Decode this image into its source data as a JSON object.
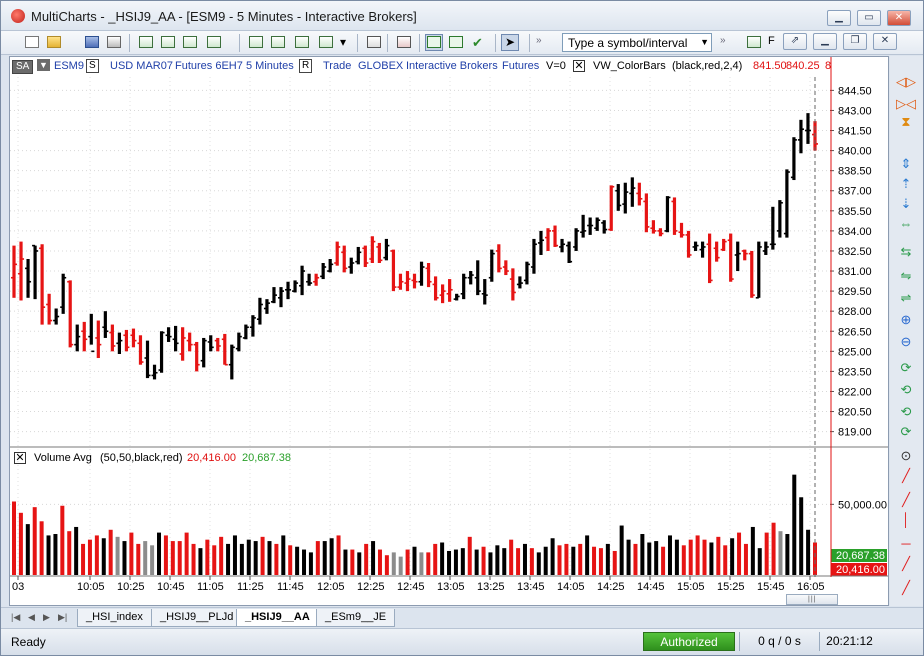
{
  "window": {
    "title": "MultiCharts - _HSIJ9_AA - [ESM9 - 5 Minutes - Interactive Brokers]",
    "buttons": [
      "_",
      "▭",
      "✕"
    ]
  },
  "toolbar": {
    "symbol_placeholder": "Type a symbol/interval",
    "overflow_label": "F"
  },
  "status_line": {
    "sa_label": "SA",
    "symbol": "ESM9",
    "s_box": "S",
    "currency": "USD MAR07",
    "futures": "Futures 6EH7",
    "interval": "5 Minutes",
    "r_box": "R",
    "trade": "Trade",
    "exchange": "GLOBEX",
    "broker": "Interactive Brokers",
    "category": "Futures",
    "v_zero": "V=0",
    "indicator": "VW_ColorBars",
    "indicator_params": "(black,red,2,4)",
    "val1": "841.50",
    "val2": "840.25",
    "val3": "8"
  },
  "volume_status": {
    "name": "Volume Avg",
    "params": "(50,50,black,red)",
    "val_red": "20,416.00",
    "val_green": "20,687.38"
  },
  "colors": {
    "up": "#000000",
    "down": "#e61414",
    "neutral": "#8c8c8c",
    "avg_red": "#e61414",
    "avg_green": "#2aa02a"
  },
  "chart_data": {
    "type": "bar",
    "title": "",
    "price_axis": {
      "min": 818.0,
      "max": 845.5,
      "ticks": [
        "844.50",
        "843.00",
        "841.50",
        "840.00",
        "838.50",
        "837.00",
        "835.50",
        "834.00",
        "832.50",
        "831.00",
        "829.50",
        "828.00",
        "826.50",
        "825.00",
        "823.50",
        "822.00",
        "820.50",
        "819.00"
      ]
    },
    "time_axis": {
      "ticks": [
        "03",
        "10:05",
        "10:25",
        "10:45",
        "11:05",
        "11:25",
        "11:45",
        "12:05",
        "12:25",
        "12:45",
        "13:05",
        "13:25",
        "13:45",
        "14:05",
        "14:25",
        "14:45",
        "15:05",
        "15:25",
        "15:45",
        "16:05"
      ]
    },
    "ohlc": [
      [
        830.5,
        832.9,
        829.0,
        831.5,
        "down"
      ],
      [
        830.8,
        833.2,
        828.8,
        831.9,
        "down"
      ],
      [
        831.2,
        831.9,
        829.0,
        830.2,
        "up"
      ],
      [
        832.9,
        832.9,
        828.9,
        832.5,
        "up"
      ],
      [
        832.7,
        833.0,
        827.0,
        828.3,
        "down"
      ],
      [
        828.5,
        829.3,
        827.0,
        827.3,
        "down"
      ],
      [
        827.3,
        828.2,
        827.0,
        827.6,
        "up"
      ],
      [
        828.3,
        830.8,
        827.8,
        830.5,
        "up"
      ],
      [
        830.2,
        830.3,
        825.3,
        825.5,
        "down"
      ],
      [
        825.5,
        827.0,
        825.0,
        826.1,
        "up"
      ],
      [
        826.5,
        827.2,
        825.0,
        825.9,
        "down"
      ],
      [
        826.1,
        827.8,
        825.5,
        825.0,
        "up"
      ],
      [
        826.0,
        827.3,
        824.5,
        825.5,
        "down"
      ],
      [
        826.8,
        828.0,
        826.0,
        826.5,
        "up"
      ],
      [
        826.4,
        827.0,
        825.0,
        825.4,
        "down"
      ],
      [
        825.6,
        826.4,
        824.8,
        825.8,
        "up"
      ],
      [
        826.2,
        826.6,
        825.0,
        825.3,
        "down"
      ],
      [
        826.2,
        826.7,
        825.3,
        825.8,
        "down"
      ],
      [
        825.6,
        826.2,
        824.0,
        824.2,
        "down"
      ],
      [
        824.5,
        825.8,
        823.0,
        823.2,
        "up"
      ],
      [
        823.2,
        824.0,
        822.9,
        823.4,
        "up"
      ],
      [
        823.6,
        826.5,
        823.4,
        826.4,
        "up"
      ],
      [
        826.2,
        826.8,
        825.7,
        826.1,
        "up"
      ],
      [
        825.9,
        826.9,
        825.0,
        825.6,
        "up"
      ],
      [
        824.8,
        826.8,
        824.3,
        826.0,
        "down"
      ],
      [
        825.8,
        826.4,
        825.0,
        825.5,
        "down"
      ],
      [
        825.5,
        825.7,
        823.5,
        824.0,
        "down"
      ],
      [
        824.3,
        826.0,
        823.8,
        825.8,
        "up"
      ],
      [
        825.7,
        826.2,
        825.0,
        825.3,
        "up"
      ],
      [
        825.8,
        826.0,
        825.0,
        825.4,
        "down"
      ],
      [
        825.9,
        826.3,
        824.0,
        824.0,
        "down"
      ],
      [
        824.0,
        825.5,
        822.9,
        825.3,
        "up"
      ],
      [
        825.2,
        826.4,
        825.0,
        826.1,
        "up"
      ],
      [
        826.0,
        827.0,
        825.9,
        826.8,
        "up"
      ],
      [
        826.8,
        827.7,
        826.1,
        827.5,
        "up"
      ],
      [
        827.4,
        829.0,
        827.0,
        828.5,
        "up"
      ],
      [
        828.2,
        828.9,
        827.8,
        828.6,
        "up"
      ],
      [
        828.7,
        829.8,
        828.6,
        829.2,
        "up"
      ],
      [
        829.0,
        829.8,
        828.3,
        829.5,
        "up"
      ],
      [
        829.6,
        830.2,
        828.9,
        829.6,
        "up"
      ],
      [
        829.5,
        830.3,
        829.4,
        830.1,
        "up"
      ],
      [
        829.9,
        831.4,
        829.2,
        831.0,
        "up"
      ],
      [
        830.2,
        830.8,
        829.9,
        830.1,
        "up"
      ],
      [
        830.2,
        830.8,
        829.9,
        830.5,
        "down"
      ],
      [
        830.6,
        831.6,
        830.4,
        831.3,
        "up"
      ],
      [
        831.0,
        831.9,
        830.9,
        831.5,
        "up"
      ],
      [
        831.6,
        833.2,
        831.4,
        832.8,
        "down"
      ],
      [
        832.4,
        832.9,
        830.9,
        831.2,
        "down"
      ],
      [
        831.3,
        832.0,
        830.8,
        831.6,
        "up"
      ],
      [
        831.7,
        832.8,
        831.5,
        832.4,
        "up"
      ],
      [
        832.7,
        832.9,
        831.3,
        831.6,
        "down"
      ],
      [
        831.9,
        833.6,
        831.6,
        833.2,
        "down"
      ],
      [
        832.8,
        833.1,
        831.6,
        831.8,
        "down"
      ],
      [
        832.0,
        833.4,
        831.8,
        832.9,
        "up"
      ],
      [
        832.5,
        832.6,
        829.5,
        829.8,
        "down"
      ],
      [
        829.8,
        830.8,
        829.6,
        830.2,
        "down"
      ],
      [
        830.1,
        831.0,
        829.5,
        830.4,
        "down"
      ],
      [
        830.3,
        830.8,
        829.7,
        830.2,
        "down"
      ],
      [
        830.2,
        831.7,
        829.9,
        831.3,
        "up"
      ],
      [
        831.2,
        831.6,
        829.8,
        830.2,
        "down"
      ],
      [
        830.0,
        830.6,
        828.8,
        829.0,
        "down"
      ],
      [
        829.2,
        830.0,
        828.6,
        829.5,
        "down"
      ],
      [
        829.3,
        830.4,
        828.7,
        829.6,
        "down"
      ],
      [
        828.9,
        829.3,
        828.8,
        829.1,
        "up"
      ],
      [
        829.3,
        830.8,
        828.9,
        830.5,
        "up"
      ],
      [
        830.5,
        831.0,
        830.0,
        830.7,
        "up"
      ],
      [
        830.5,
        831.8,
        829.2,
        829.5,
        "up"
      ],
      [
        829.3,
        830.4,
        828.5,
        829.2,
        "up"
      ],
      [
        830.5,
        832.6,
        830.2,
        832.3,
        "up"
      ],
      [
        832.5,
        833.0,
        830.9,
        831.2,
        "down"
      ],
      [
        831.3,
        831.8,
        830.7,
        831.0,
        "down"
      ],
      [
        830.4,
        831.2,
        828.8,
        829.4,
        "down"
      ],
      [
        830.0,
        830.6,
        829.7,
        830.1,
        "up"
      ],
      [
        830.3,
        831.7,
        830.0,
        831.5,
        "up"
      ],
      [
        831.3,
        833.4,
        830.8,
        833.0,
        "up"
      ],
      [
        833.1,
        834.0,
        832.2,
        833.3,
        "up"
      ],
      [
        833.5,
        834.2,
        832.5,
        834.0,
        "down"
      ],
      [
        834.0,
        834.4,
        832.8,
        832.9,
        "down"
      ],
      [
        832.8,
        833.4,
        832.4,
        833.0,
        "up"
      ],
      [
        832.9,
        833.2,
        831.6,
        831.7,
        "up"
      ],
      [
        832.8,
        834.2,
        832.5,
        834.0,
        "up"
      ],
      [
        833.9,
        835.2,
        833.5,
        834.0,
        "up"
      ],
      [
        834.4,
        835.0,
        833.7,
        834.4,
        "up"
      ],
      [
        834.2,
        835.0,
        834.0,
        834.8,
        "up"
      ],
      [
        834.6,
        834.8,
        833.8,
        834.1,
        "up"
      ],
      [
        834.1,
        837.4,
        834.0,
        837.3,
        "down"
      ],
      [
        837.0,
        837.5,
        835.5,
        835.9,
        "up"
      ],
      [
        836.0,
        837.6,
        835.3,
        836.9,
        "up"
      ],
      [
        836.8,
        838.0,
        835.8,
        837.2,
        "up"
      ],
      [
        836.8,
        837.6,
        835.9,
        836.4,
        "down"
      ],
      [
        836.2,
        836.8,
        833.9,
        834.3,
        "down"
      ],
      [
        834.2,
        834.8,
        833.8,
        834.0,
        "down"
      ],
      [
        834.0,
        834.2,
        833.6,
        833.8,
        "down"
      ],
      [
        834.0,
        836.6,
        833.9,
        836.5,
        "up"
      ],
      [
        836.2,
        836.5,
        833.7,
        834.0,
        "down"
      ],
      [
        833.9,
        834.6,
        833.5,
        833.7,
        "down"
      ],
      [
        833.7,
        834.0,
        832.0,
        832.2,
        "down"
      ],
      [
        832.8,
        833.2,
        832.5,
        832.9,
        "up"
      ],
      [
        832.6,
        833.2,
        832.0,
        832.8,
        "up"
      ],
      [
        833.0,
        833.8,
        830.1,
        830.3,
        "down"
      ],
      [
        832.7,
        833.2,
        831.7,
        832.0,
        "down"
      ],
      [
        832.6,
        833.4,
        832.5,
        833.2,
        "down"
      ],
      [
        833.3,
        833.8,
        830.2,
        830.4,
        "down"
      ],
      [
        832.2,
        833.2,
        831.0,
        832.3,
        "up"
      ],
      [
        832.5,
        832.6,
        831.8,
        832.3,
        "down"
      ],
      [
        832.3,
        832.5,
        829.0,
        829.2,
        "down"
      ],
      [
        829.0,
        833.2,
        829.0,
        832.8,
        "up"
      ],
      [
        832.5,
        833.2,
        832.2,
        832.8,
        "up"
      ],
      [
        833.0,
        835.8,
        832.6,
        833.0,
        "up"
      ],
      [
        834.0,
        836.3,
        833.5,
        836.1,
        "up"
      ],
      [
        833.8,
        838.6,
        833.5,
        838.4,
        "up"
      ],
      [
        838.0,
        841.0,
        837.8,
        840.8,
        "up"
      ],
      [
        840.8,
        842.3,
        839.8,
        841.6,
        "up"
      ],
      [
        841.5,
        842.8,
        840.5,
        841.5,
        "up"
      ],
      [
        841.2,
        842.2,
        840.0,
        840.5,
        "down"
      ]
    ],
    "volume_axis": {
      "max": 75000,
      "ticks": [
        "50,000.00"
      ]
    },
    "volume": [
      [
        52000,
        "down"
      ],
      [
        44000,
        "down"
      ],
      [
        36000,
        "up"
      ],
      [
        48000,
        "down"
      ],
      [
        38000,
        "down"
      ],
      [
        28000,
        "up"
      ],
      [
        29000,
        "up"
      ],
      [
        49000,
        "down"
      ],
      [
        31000,
        "down"
      ],
      [
        34000,
        "up"
      ],
      [
        22000,
        "down"
      ],
      [
        25000,
        "down"
      ],
      [
        28000,
        "down"
      ],
      [
        26000,
        "up"
      ],
      [
        32000,
        "down"
      ],
      [
        27000,
        "neutral"
      ],
      [
        24000,
        "up"
      ],
      [
        30000,
        "down"
      ],
      [
        22000,
        "down"
      ],
      [
        24000,
        "neutral"
      ],
      [
        21000,
        "neutral"
      ],
      [
        30000,
        "up"
      ],
      [
        28000,
        "down"
      ],
      [
        24000,
        "down"
      ],
      [
        24000,
        "down"
      ],
      [
        30000,
        "down"
      ],
      [
        22000,
        "down"
      ],
      [
        19000,
        "up"
      ],
      [
        25000,
        "down"
      ],
      [
        21000,
        "down"
      ],
      [
        27000,
        "down"
      ],
      [
        22000,
        "up"
      ],
      [
        28000,
        "up"
      ],
      [
        22000,
        "up"
      ],
      [
        25000,
        "up"
      ],
      [
        24000,
        "up"
      ],
      [
        27000,
        "down"
      ],
      [
        24000,
        "up"
      ],
      [
        22000,
        "down"
      ],
      [
        28000,
        "up"
      ],
      [
        21000,
        "down"
      ],
      [
        20000,
        "up"
      ],
      [
        18000,
        "up"
      ],
      [
        16000,
        "up"
      ],
      [
        24000,
        "down"
      ],
      [
        24000,
        "up"
      ],
      [
        26000,
        "up"
      ],
      [
        28000,
        "down"
      ],
      [
        18000,
        "up"
      ],
      [
        18000,
        "down"
      ],
      [
        16000,
        "up"
      ],
      [
        22000,
        "down"
      ],
      [
        24000,
        "up"
      ],
      [
        18000,
        "down"
      ],
      [
        14000,
        "down"
      ],
      [
        16000,
        "neutral"
      ],
      [
        13000,
        "neutral"
      ],
      [
        18000,
        "down"
      ],
      [
        20000,
        "up"
      ],
      [
        16000,
        "neutral"
      ],
      [
        16000,
        "down"
      ],
      [
        22000,
        "down"
      ],
      [
        23000,
        "up"
      ],
      [
        17000,
        "up"
      ],
      [
        18000,
        "up"
      ],
      [
        19000,
        "up"
      ],
      [
        27000,
        "down"
      ],
      [
        18000,
        "up"
      ],
      [
        20000,
        "down"
      ],
      [
        16000,
        "up"
      ],
      [
        21000,
        "up"
      ],
      [
        19000,
        "up"
      ],
      [
        25000,
        "down"
      ],
      [
        19000,
        "down"
      ],
      [
        22000,
        "up"
      ],
      [
        19000,
        "down"
      ],
      [
        16000,
        "up"
      ],
      [
        20000,
        "up"
      ],
      [
        26000,
        "up"
      ],
      [
        21000,
        "down"
      ],
      [
        22000,
        "down"
      ],
      [
        20000,
        "up"
      ],
      [
        22000,
        "down"
      ],
      [
        28000,
        "up"
      ],
      [
        20000,
        "down"
      ],
      [
        19000,
        "down"
      ],
      [
        22000,
        "up"
      ],
      [
        17000,
        "down"
      ],
      [
        35000,
        "up"
      ],
      [
        25000,
        "up"
      ],
      [
        22000,
        "down"
      ],
      [
        29000,
        "up"
      ],
      [
        23000,
        "up"
      ],
      [
        24000,
        "up"
      ],
      [
        20000,
        "down"
      ],
      [
        28000,
        "up"
      ],
      [
        25000,
        "up"
      ],
      [
        21000,
        "down"
      ],
      [
        25000,
        "down"
      ],
      [
        28000,
        "down"
      ],
      [
        25000,
        "down"
      ],
      [
        23000,
        "up"
      ],
      [
        27000,
        "down"
      ],
      [
        21000,
        "down"
      ],
      [
        26000,
        "up"
      ],
      [
        30000,
        "down"
      ],
      [
        22000,
        "down"
      ],
      [
        34000,
        "up"
      ],
      [
        19000,
        "up"
      ],
      [
        30000,
        "down"
      ],
      [
        37000,
        "down"
      ],
      [
        31000,
        "neutral"
      ],
      [
        29000,
        "up"
      ],
      [
        71000,
        "up"
      ],
      [
        55000,
        "up"
      ],
      [
        32000,
        "up"
      ],
      [
        23000,
        "down"
      ]
    ]
  },
  "right_toolbar": {
    "icons": [
      "◁▷",
      "▷◁",
      "⧗",
      "⇕",
      "⇡",
      "⇣",
      "⇔",
      "⇆",
      "⇋",
      "⇌",
      "⊕",
      "⊖",
      "⟳",
      "⟲",
      "⟲",
      "⟳",
      "⊙",
      "╱",
      "╱",
      "│",
      "─",
      "╱",
      "╱",
      "╱"
    ]
  },
  "tabs": {
    "items": [
      "_HSI_index",
      "_HSIJ9__PLJd",
      "_HSIJ9__AA",
      "_ESm9__JE"
    ],
    "active": "_HSIJ9__AA"
  },
  "statusbar": {
    "ready": "Ready",
    "authorized": "Authorized",
    "queue": "0 q / 0 s",
    "time": "20:21:12"
  }
}
